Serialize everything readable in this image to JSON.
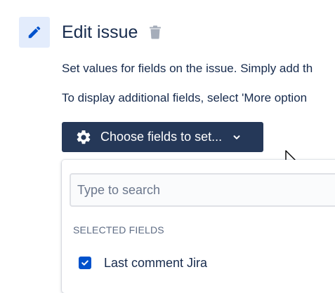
{
  "header": {
    "icon": "pencil-icon",
    "title": "Edit issue",
    "delete_icon": "trash-icon"
  },
  "description": {
    "line1": "Set values for fields on the issue. Simply add th",
    "line2": "To display additional fields, select 'More option"
  },
  "choose_button": {
    "icon": "gear-icon",
    "label": "Choose fields to set...",
    "chevron_icon": "chevron-down-icon"
  },
  "dropdown": {
    "search_placeholder": "Type to search",
    "search_value": "",
    "section_heading": "SELECTED FIELDS",
    "options": [
      {
        "label": "Last comment Jira",
        "checked": true
      }
    ]
  },
  "colors": {
    "primary_button_bg": "#253858",
    "checkbox": "#0052cc",
    "icon_box_bg": "#e3ecfc",
    "text": "#172b4d",
    "muted_text": "#5e6c84"
  }
}
